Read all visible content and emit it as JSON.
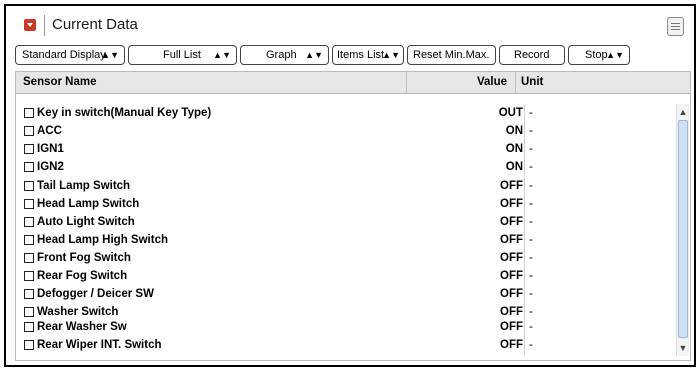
{
  "header": {
    "title": "Current Data",
    "title_icon": "collapse-arrow-icon",
    "menu_icon": "menu-icon"
  },
  "toolbar": {
    "display_mode": "Standard Display",
    "list_mode": "Full List",
    "view_mode": "Graph",
    "items_list": "Items List",
    "reset_label": "Reset Min.Max.",
    "record_label": "Record",
    "stop_label": "Stop"
  },
  "table": {
    "columns": {
      "name": "Sensor Name",
      "value": "Value",
      "unit": "Unit"
    },
    "rows": [
      {
        "name": "Key in switch(Manual Key Type)",
        "value": "OUT",
        "unit": "-"
      },
      {
        "name": "ACC",
        "value": "ON",
        "unit": "-"
      },
      {
        "name": "IGN1",
        "value": "ON",
        "unit": "-"
      },
      {
        "name": "IGN2",
        "value": "ON",
        "unit": "-"
      },
      {
        "name": "Tail Lamp Switch",
        "value": "OFF",
        "unit": "-"
      },
      {
        "name": "Head Lamp Switch",
        "value": "OFF",
        "unit": "-"
      },
      {
        "name": "Auto Light Switch",
        "value": "OFF",
        "unit": "-"
      },
      {
        "name": "Head Lamp High Switch",
        "value": "OFF",
        "unit": "-"
      },
      {
        "name": "Front Fog Switch",
        "value": "OFF",
        "unit": "-"
      },
      {
        "name": "Rear Fog Switch",
        "value": "OFF",
        "unit": "-"
      },
      {
        "name": "Defogger / Deicer SW",
        "value": "OFF",
        "unit": "-"
      },
      {
        "name": "Washer Switch",
        "value": "OFF",
        "unit": "-"
      },
      {
        "name": "Rear Washer Sw",
        "value": "OFF",
        "unit": "-"
      },
      {
        "name": "Rear Wiper INT. Switch",
        "value": "OFF",
        "unit": "-"
      }
    ]
  },
  "colors": {
    "accent": "#c83a22",
    "header_bg": "#e6e6e6",
    "scroll_thumb": "#cfe0f2"
  }
}
